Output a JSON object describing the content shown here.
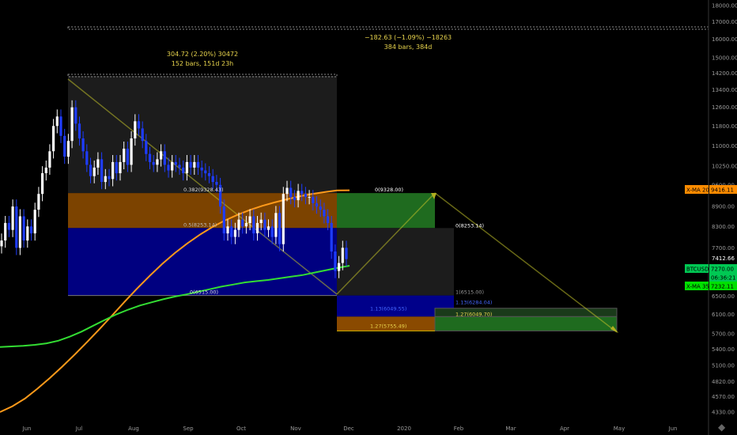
{
  "chart_data": {
    "type": "candlestick",
    "symbol": "BTCUSD",
    "x_ticks": [
      "Jun",
      "Jul",
      "Aug",
      "Sep",
      "Oct",
      "Nov",
      "Dec",
      "2020",
      "Feb",
      "Mar",
      "Apr",
      "May",
      "Jun"
    ],
    "y_ticks": [
      "18000.00",
      "17000.00",
      "16000.00",
      "15000.00",
      "14200.00",
      "13400.00",
      "12600.00",
      "11800.00",
      "11000.00",
      "10250.00",
      "9600.00",
      "8900.00",
      "8300.00",
      "7700.00",
      "7100.00",
      "6500.00",
      "6100.00",
      "5700.00",
      "5400.00",
      "5100.00",
      "4820.00",
      "4570.00",
      "4330.00"
    ],
    "y_scale": "log",
    "close_series": [
      7900,
      8400,
      8200,
      8900,
      7700,
      8600,
      7900,
      8300,
      8100,
      8800,
      9300,
      10000,
      10200,
      10800,
      11800,
      12200,
      11400,
      10600,
      11200,
      12600,
      11900,
      11300,
      10800,
      10300,
      9900,
      10200,
      10500,
      9700,
      9900,
      9800,
      10400,
      10000,
      10400,
      10900,
      10300,
      11300,
      12000,
      11700,
      11200,
      10700,
      10400,
      10300,
      10500,
      10800,
      10300,
      10100,
      10400,
      10300,
      10200,
      10000,
      10400,
      10200,
      10400,
      10200,
      10100,
      10000,
      9900,
      9700,
      9600,
      8900,
      8100,
      8300,
      8000,
      8200,
      8500,
      8300,
      8400,
      8600,
      8100,
      8400,
      8500,
      8200,
      8300,
      8000,
      8700,
      7800,
      9300,
      9500,
      9200,
      9100,
      9400,
      9300,
      9200,
      9200,
      9000,
      8900,
      8800,
      8600,
      8400,
      7600,
      7100,
      7300,
      7700,
      7400
    ],
    "ma200_series": [
      4330,
      4420,
      4540,
      4700,
      4880,
      5080,
      5300,
      5540,
      5800,
      6080,
      6380,
      6680,
      6980,
      7280,
      7560,
      7820,
      8060,
      8280,
      8470,
      8640,
      8790,
      8920,
      9030,
      9130,
      9220,
      9300,
      9360,
      9416,
      9420
    ],
    "ma350_series": [
      5440,
      5450,
      5460,
      5480,
      5510,
      5560,
      5640,
      5740,
      5860,
      5980,
      6100,
      6200,
      6290,
      6360,
      6430,
      6490,
      6540,
      6600,
      6660,
      6720,
      6770,
      6820,
      6850,
      6880,
      6920,
      6960,
      7000,
      7060,
      7120,
      7180,
      7232
    ],
    "annotations": [
      {
        "line1": "304.72 (2.20%) 30472",
        "line2": "152 bars, 151d 23h"
      },
      {
        "line1": "−182.63 (−1.09%) −18263",
        "line2": "384 bars, 384d"
      }
    ],
    "fib_left": [
      "0.382(9328.43)",
      "0.5(8253.14)",
      "0(6515.00)"
    ],
    "fib_right": [
      "0(9328.00)",
      "0(8253.14)",
      "1(6515.00)",
      "1.13(6284.04)",
      "1.27(6049.70)",
      "1.27(5755.49)",
      "1.13(6049.55)"
    ],
    "price_labels": [
      {
        "name": "X-MA 200",
        "value": "9416.11",
        "color": "#ff8c00"
      },
      {
        "name": "",
        "value": "7412.66",
        "color": "#000000"
      },
      {
        "name": "BTCUSD",
        "value": "7270.00",
        "color": "#00c853"
      },
      {
        "name": "",
        "value": "06:36:21",
        "color": "#00c853"
      },
      {
        "name": "X-MA 350",
        "value": "7232.11",
        "color": "#00e000"
      }
    ],
    "colors": {
      "up": "#ffffff",
      "down": "#1e3cff",
      "ma200": "#ff9a1a",
      "ma350": "#33dd33",
      "fib_orange": "#8a4a00",
      "fib_blue": "#000080",
      "fib_green": "#1f6b1f"
    }
  }
}
